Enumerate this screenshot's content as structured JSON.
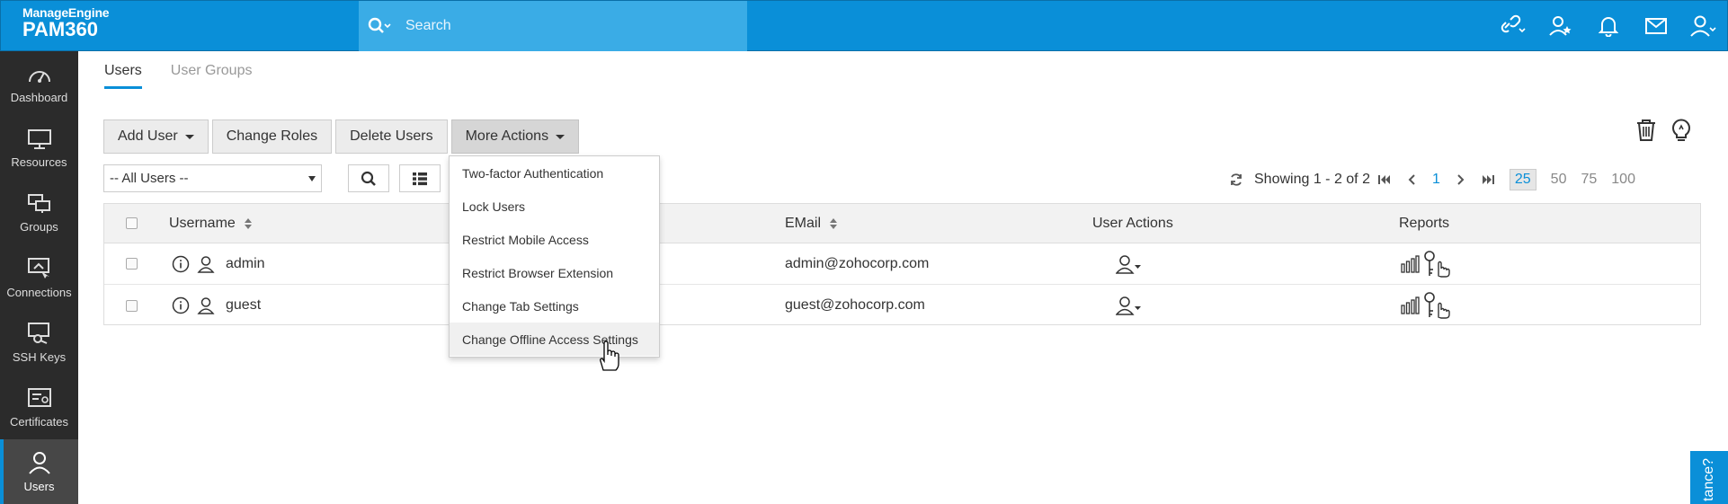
{
  "brand": {
    "company": "ManageEngine",
    "product": "PAM360"
  },
  "search": {
    "placeholder": "Search"
  },
  "top_icons": [
    "link-dropdown-icon",
    "user-star-icon",
    "bell-icon",
    "mail-icon",
    "user-dropdown-icon"
  ],
  "sidebar": {
    "items": [
      {
        "label": "Dashboard",
        "icon": "dashboard-icon"
      },
      {
        "label": "Resources",
        "icon": "monitor-icon"
      },
      {
        "label": "Groups",
        "icon": "groups-icon"
      },
      {
        "label": "Connections",
        "icon": "connections-icon"
      },
      {
        "label": "SSH Keys",
        "icon": "ssh-key-icon"
      },
      {
        "label": "Certificates",
        "icon": "certificate-icon"
      },
      {
        "label": "Users",
        "icon": "user-icon",
        "active": true
      }
    ]
  },
  "tabs": [
    {
      "label": "Users",
      "active": true
    },
    {
      "label": "User Groups",
      "active": false
    }
  ],
  "toolbar": {
    "add_user": "Add User",
    "change_roles": "Change Roles",
    "delete_users": "Delete Users",
    "more_actions": "More Actions"
  },
  "filter": {
    "selected": "-- All Users --"
  },
  "pagination": {
    "showing": "Showing 1 - 2 of 2",
    "current_page": "1",
    "page_sizes": [
      "25",
      "50",
      "75",
      "100"
    ],
    "selected_size": "25"
  },
  "table": {
    "headers": {
      "username": "Username",
      "email": "EMail",
      "user_actions": "User Actions",
      "reports": "Reports"
    },
    "rows": [
      {
        "username": "admin",
        "email": "admin@zohocorp.com"
      },
      {
        "username": "guest",
        "email": "guest@zohocorp.com"
      }
    ]
  },
  "more_actions_menu": {
    "items": [
      "Two-factor Authentication",
      "Lock Users",
      "Restrict Mobile Access",
      "Restrict Browser Extension",
      "Change Tab Settings",
      "Change Offline Access Settings"
    ],
    "hovered_index": 5
  },
  "assist_tab": {
    "label": "tance?"
  },
  "colors": {
    "primary": "#0a8fd8",
    "sidebar": "#2b2b2b",
    "search_bg": "#3aace6"
  }
}
